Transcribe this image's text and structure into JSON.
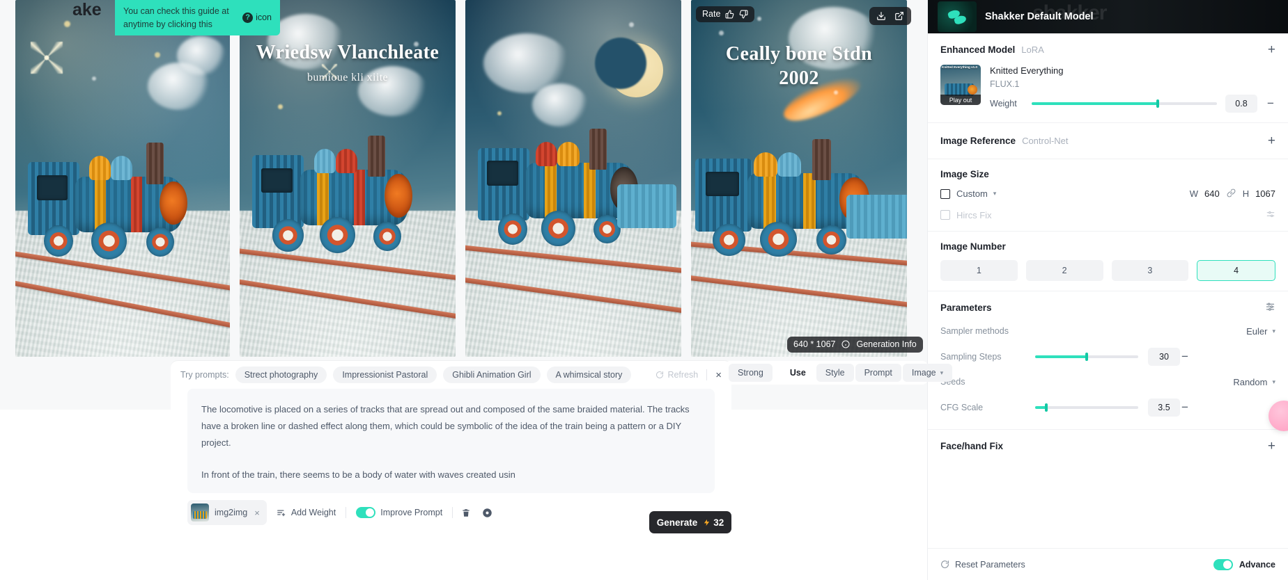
{
  "tooltip": {
    "text": "You can check this guide at anytime by clicking this",
    "icon_label": "icon",
    "badge": "?"
  },
  "logo_text": "ake",
  "gallery": {
    "rate_label": "Rate",
    "size_badge": "640 * 1067",
    "generation_info": "Generation Info",
    "images": [
      {
        "name": "image-1",
        "title": "",
        "subtitle": ""
      },
      {
        "name": "image-2",
        "title": "Wriedsw Vlanchleate",
        "subtitle": "bumioue kli xiite"
      },
      {
        "name": "image-3",
        "title": "",
        "subtitle": ""
      },
      {
        "name": "image-4",
        "title": "Ceally bone Stdn",
        "subtitle": "2002"
      }
    ]
  },
  "prompt_panel": {
    "try_label": "Try prompts:",
    "chips": [
      "Strect photography",
      "Impressionist Pastoral",
      "Ghibli Animation Girl",
      "A whimsical story"
    ],
    "refresh_label": "Refresh",
    "close_label": "×",
    "text_lines": [
      "The locomotive is placed on a series of tracks that are spread out and composed of the same braided material. The tracks have a broken line or dashed effect along them, which could be symbolic of the idea of the train being a pattern or a DIY project.",
      "In front of the train, there seems to be a body of water with waves created usin"
    ],
    "attachment_label": "img2img",
    "attachment_remove": "×",
    "add_weight_label": "Add Weight",
    "improve_prompt_label": "Improve Prompt",
    "improve_prompt_on": true,
    "generate_label": "Generate",
    "generate_cost": "32",
    "bolt_icon": "lightning-icon"
  },
  "control_strip": {
    "items": [
      "Strong",
      "Use",
      "Style",
      "Prompt",
      "Image"
    ]
  },
  "right_panel": {
    "model_banner": {
      "name": "Shakker Default Model",
      "watermark": "shakker"
    },
    "enhanced_model": {
      "title": "Enhanced Model",
      "tag": "LoRA",
      "add": "+",
      "lora_name": "Knitted Everything",
      "base_model": "FLUX.1",
      "thumb_caption": "Play out",
      "thumb_title": "Knitted Everything v1.0",
      "weight_label": "Weight",
      "weight_value": "0.8",
      "weight_percent": 68,
      "minus": "−"
    },
    "image_reference": {
      "title": "Image Reference",
      "tag": "Control-Net",
      "add": "+"
    },
    "image_size": {
      "title": "Image Size",
      "preset": "Custom",
      "w_label": "W",
      "w_value": "640",
      "h_label": "H",
      "h_value": "1067",
      "link_icon": "link-icon",
      "hires_label": "Hircs Fix",
      "hires_checked": false
    },
    "image_number": {
      "title": "Image Number",
      "options": [
        "1",
        "2",
        "3",
        "4"
      ],
      "selected": "4"
    },
    "parameters": {
      "title": "Parameters",
      "settings_icon": "sliders-icon",
      "sampler_label": "Sampler methods",
      "sampler_value": "Euler",
      "steps_label": "Sampling Steps",
      "steps_value": "30",
      "steps_percent": 50,
      "seeds_label": "Seeds",
      "seeds_value": "Random",
      "cfg_label": "CFG Scale",
      "cfg_value": "3.5",
      "cfg_percent": 11
    },
    "face_hand_fix": {
      "title": "Face/hand Fix",
      "add": "+"
    },
    "footer": {
      "reset_label": "Reset Parameters",
      "reset_icon": "refresh-icon",
      "advance_label": "Advance",
      "advance_on": true
    }
  },
  "colors": {
    "accent": "#2ee0bc",
    "dark_button": "#27282c",
    "panel_bg": "#ffffff",
    "page_bg": "#f7f8f9",
    "text_primary": "#1d2129",
    "text_secondary": "#4e5969",
    "text_muted": "#86909c"
  }
}
